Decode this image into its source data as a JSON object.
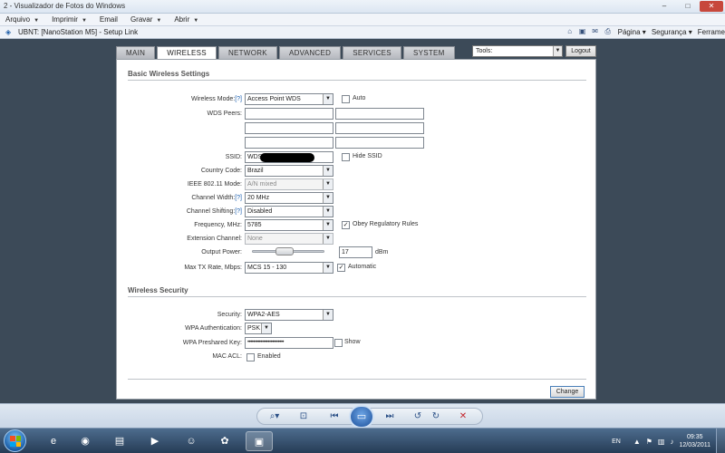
{
  "window": {
    "title": "2 - Visualizador de Fotos do Windows",
    "min": "–",
    "max": "□",
    "close": "✕"
  },
  "menubar": {
    "items": [
      "Arquivo",
      "Imprimir",
      "Email",
      "Gravar",
      "Abrir"
    ]
  },
  "ie": {
    "tab_title": "UBNT: [NanoStation M5] - Setup Link",
    "menus": [
      "Página",
      "Segurança",
      "Ferrame"
    ]
  },
  "tabs": [
    "MAIN",
    "WIRELESS",
    "NETWORK",
    "ADVANCED",
    "SERVICES",
    "SYSTEM"
  ],
  "active_tab": "WIRELESS",
  "tools": {
    "label": "Tools:"
  },
  "logout": "Logout",
  "basic": {
    "section_title": "Basic Wireless Settings",
    "wireless_mode": {
      "label": "Wireless Mode:",
      "help": "[?]",
      "value": "Access Point WDS",
      "auto_label": "Auto"
    },
    "wds_peers": {
      "label": "WDS Peers:"
    },
    "ssid": {
      "label": "SSID:",
      "value": "WDS",
      "hide_label": "Hide SSID"
    },
    "country": {
      "label": "Country Code:",
      "value": "Brazil"
    },
    "ieee_mode": {
      "label": "IEEE 802.11 Mode:",
      "value": "A/N mixed"
    },
    "channel_width": {
      "label": "Channel Width:",
      "help": "[?]",
      "value": "20 MHz"
    },
    "channel_shifting": {
      "label": "Channel Shifting:",
      "help": "[?]",
      "value": "Disabled"
    },
    "frequency": {
      "label": "Frequency, MHz:",
      "value": "5785",
      "obey_label": "Obey Regulatory Rules"
    },
    "extension_channel": {
      "label": "Extension Channel:",
      "value": "None"
    },
    "output_power": {
      "label": "Output Power:",
      "value": "17",
      "unit": "dBm"
    },
    "max_tx_rate": {
      "label": "Max TX Rate, Mbps:",
      "value": "MCS 15 - 130",
      "auto_label": "Automatic"
    }
  },
  "security": {
    "section_title": "Wireless Security",
    "security": {
      "label": "Security:",
      "value": "WPA2-AES"
    },
    "wpa_auth": {
      "label": "WPA Authentication:",
      "value": "PSK"
    },
    "psk": {
      "label": "WPA Preshared Key:",
      "value": "•••••••••••••••••••••••••",
      "show_label": "Show"
    },
    "mac_acl": {
      "label": "MAC ACL:",
      "enabled_label": "Enabled"
    }
  },
  "change_button": "Change",
  "taskbar": {
    "lang": "EN",
    "time": "09:35",
    "date": "12/03/2011"
  }
}
